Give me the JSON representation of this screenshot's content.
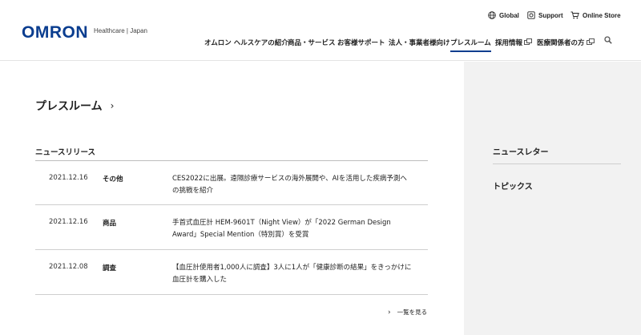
{
  "header": {
    "logo": "OMRON",
    "logo_sub": "Healthcare | Japan",
    "utility": {
      "global": "Global",
      "support": "Support",
      "store": "Online Store"
    },
    "nav": [
      "オムロン ヘルスケアの紹介",
      "商品・サービス",
      "お客様サポート",
      "法人・事業者様向け",
      "プレスルーム",
      "採用情報",
      "医療関係者の方"
    ]
  },
  "main": {
    "page_title": "プレスルーム",
    "section_title": "ニュースリリース",
    "releases": [
      {
        "date": "2021.12.16",
        "category": "その他",
        "text": "CES2022に出展。遠隔診療サービスの海外展開や、AIを活用した疾病予測への挑戦を紹介"
      },
      {
        "date": "2021.12.16",
        "category": "商品",
        "text": "手首式血圧計 HEM-9601T（Night View）が「2022 German Design Award」Special Mention（特別賞）を受賞"
      },
      {
        "date": "2021.12.08",
        "category": "調査",
        "text": "【血圧計使用者1,000人に調査】3人に1人が「健康診断の結果」をきっかけに血圧計を購入した"
      }
    ],
    "more_link": "一覧を見る"
  },
  "sidebar": {
    "items": [
      "ニュースレター",
      "トピックス"
    ]
  },
  "colors": {
    "brand": "#0a3d8f",
    "sidebar_bg": "#f2f2f2"
  },
  "icons": [
    "globe-icon",
    "support-icon",
    "cart-icon",
    "search-icon",
    "external-link-icon",
    "chevron-right-icon"
  ]
}
